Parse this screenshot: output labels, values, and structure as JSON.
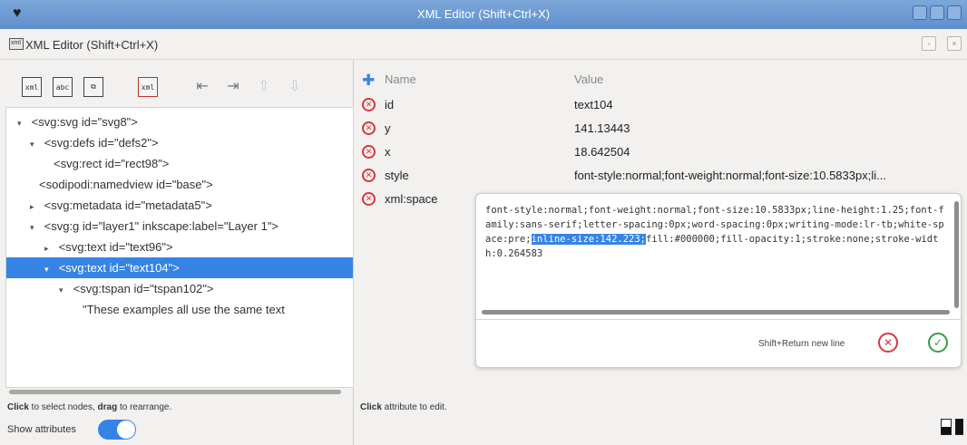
{
  "window": {
    "title": "XML Editor (Shift+Ctrl+X)",
    "app_icon": "inkscape-icon"
  },
  "dock": {
    "title": "XML Editor (Shift+Ctrl+X)"
  },
  "toolbar": {
    "buttons": [
      {
        "icon": "new-element-node-icon",
        "text": "xml"
      },
      {
        "icon": "new-text-node-icon",
        "text": "abc"
      },
      {
        "icon": "duplicate-node-icon",
        "text": ""
      },
      {
        "icon": "delete-node-icon",
        "text": "xml"
      },
      {
        "icon": "unindent-node-icon"
      },
      {
        "icon": "indent-node-icon"
      },
      {
        "icon": "raise-node-icon"
      },
      {
        "icon": "lower-node-icon"
      }
    ]
  },
  "tree": {
    "nodes": [
      {
        "text": "<svg:svg id=\"svg8\">",
        "expander": "▾"
      },
      {
        "text": "<svg:defs id=\"defs2\">",
        "expander": "▾"
      },
      {
        "text": "<svg:rect id=\"rect98\">",
        "expander": ""
      },
      {
        "text": "<sodipodi:namedview id=\"base\">",
        "expander": ""
      },
      {
        "text": "<svg:metadata id=\"metadata5\">",
        "expander": "▸"
      },
      {
        "text": "<svg:g id=\"layer1\" inkscape:label=\"Layer 1\">",
        "expander": "▾"
      },
      {
        "text": "<svg:text id=\"text96\">",
        "expander": "▸"
      },
      {
        "text": "<svg:text id=\"text104\">",
        "expander": "▾",
        "selected": true
      },
      {
        "text": "<svg:tspan id=\"tspan102\">",
        "expander": "▾"
      },
      {
        "text": "\"These examples all use the same text",
        "expander": ""
      }
    ],
    "hint_bold_1": "Click",
    "hint_text_1": " to select nodes, ",
    "hint_bold_2": "drag",
    "hint_text_2": " to rearrange."
  },
  "show_attributes": {
    "label": "Show attributes",
    "enabled": true
  },
  "attributes": {
    "header_name": "Name",
    "header_value": "Value",
    "rows": [
      {
        "name": "id",
        "value": "text104"
      },
      {
        "name": "y",
        "value": "141.13443"
      },
      {
        "name": "x",
        "value": "18.642504"
      },
      {
        "name": "style",
        "value": "font-style:normal;font-weight:normal;font-size:10.5833px;li..."
      },
      {
        "name": "xml:space",
        "value": ""
      }
    ],
    "hint_bold": "Click",
    "hint_text": " attribute to edit."
  },
  "editor": {
    "text_before": "font-style:normal;font-weight:normal;font-size:10.5833px;line-height:1.25;font-family:sans-serif;letter-spacing:0px;word-spacing:0px;writing-mode:lr-tb;white-space:pre;",
    "text_selected": "inline-size:142.223;",
    "text_after": "fill:#000000;fill-opacity:1;stroke:none;stroke-width:0.264583",
    "footer_hint": "Shift+Return new line",
    "cancel_icon": "cancel-icon",
    "confirm_icon": "confirm-icon"
  },
  "colors": {
    "accent": "#3584e4",
    "delete": "#d9363e",
    "confirm": "#3a9b46",
    "titlebar": "#6b9ad4"
  }
}
